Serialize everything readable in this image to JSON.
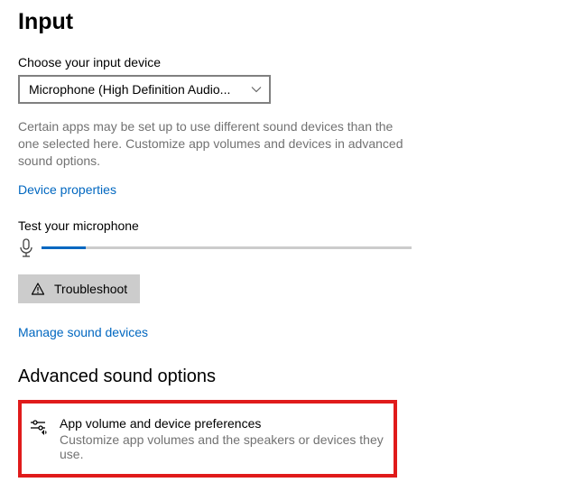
{
  "input": {
    "heading": "Input",
    "choose_label": "Choose your input device",
    "device_selected": "Microphone (High Definition Audio...",
    "helper_text": "Certain apps may be set up to use different sound devices than the one selected here. Customize app volumes and devices in advanced sound options.",
    "device_properties_link": "Device properties",
    "test_label": "Test your microphone",
    "mic_level_percent": 12,
    "troubleshoot_label": "Troubleshoot",
    "manage_devices_link": "Manage sound devices"
  },
  "advanced": {
    "heading": "Advanced sound options",
    "pref_title": "App volume and device preferences",
    "pref_subtitle": "Customize app volumes and the speakers or devices they use."
  }
}
